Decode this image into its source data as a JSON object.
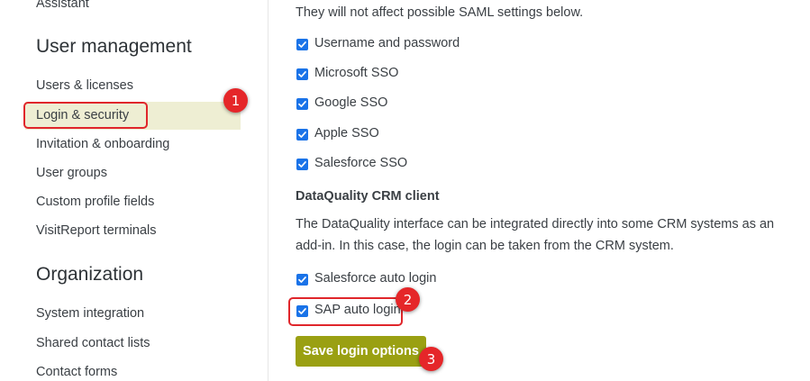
{
  "sidebar": {
    "assistant_label": "Assistant",
    "user_management_heading": "User management",
    "user_management_items": [
      {
        "label": "Users & licenses"
      },
      {
        "label": "Login & security"
      },
      {
        "label": "Invitation & onboarding"
      },
      {
        "label": "User groups"
      },
      {
        "label": "Custom profile fields"
      },
      {
        "label": "VisitReport terminals"
      }
    ],
    "organization_heading": "Organization",
    "organization_items": [
      {
        "label": "System integration"
      },
      {
        "label": "Shared contact lists"
      },
      {
        "label": "Contact forms"
      }
    ]
  },
  "main": {
    "intro_text": "They will not affect possible SAML settings below.",
    "login_options": [
      {
        "label": "Username and password",
        "checked": true
      },
      {
        "label": "Microsoft SSO",
        "checked": true
      },
      {
        "label": "Google SSO",
        "checked": true
      },
      {
        "label": "Apple SSO",
        "checked": true
      },
      {
        "label": "Salesforce SSO",
        "checked": true
      }
    ],
    "crm_section": {
      "title": "DataQuality CRM client",
      "description_line1": "The DataQuality interface can be integrated directly into some CRM systems as an",
      "description_line2": "add-in. In this case, the login can be taken from the CRM system.",
      "options": [
        {
          "label": "Salesforce auto login",
          "checked": true
        },
        {
          "label": "SAP auto login",
          "checked": true
        }
      ]
    },
    "save_button_label": "Save login options"
  },
  "annotations": {
    "badge1": "1",
    "badge2": "2",
    "badge3": "3"
  },
  "colors": {
    "accent_button": "#9aa012",
    "active_item_bg": "#eeeed3",
    "highlight_red": "#e0262b",
    "checkbox_blue": "#1a73e8"
  }
}
